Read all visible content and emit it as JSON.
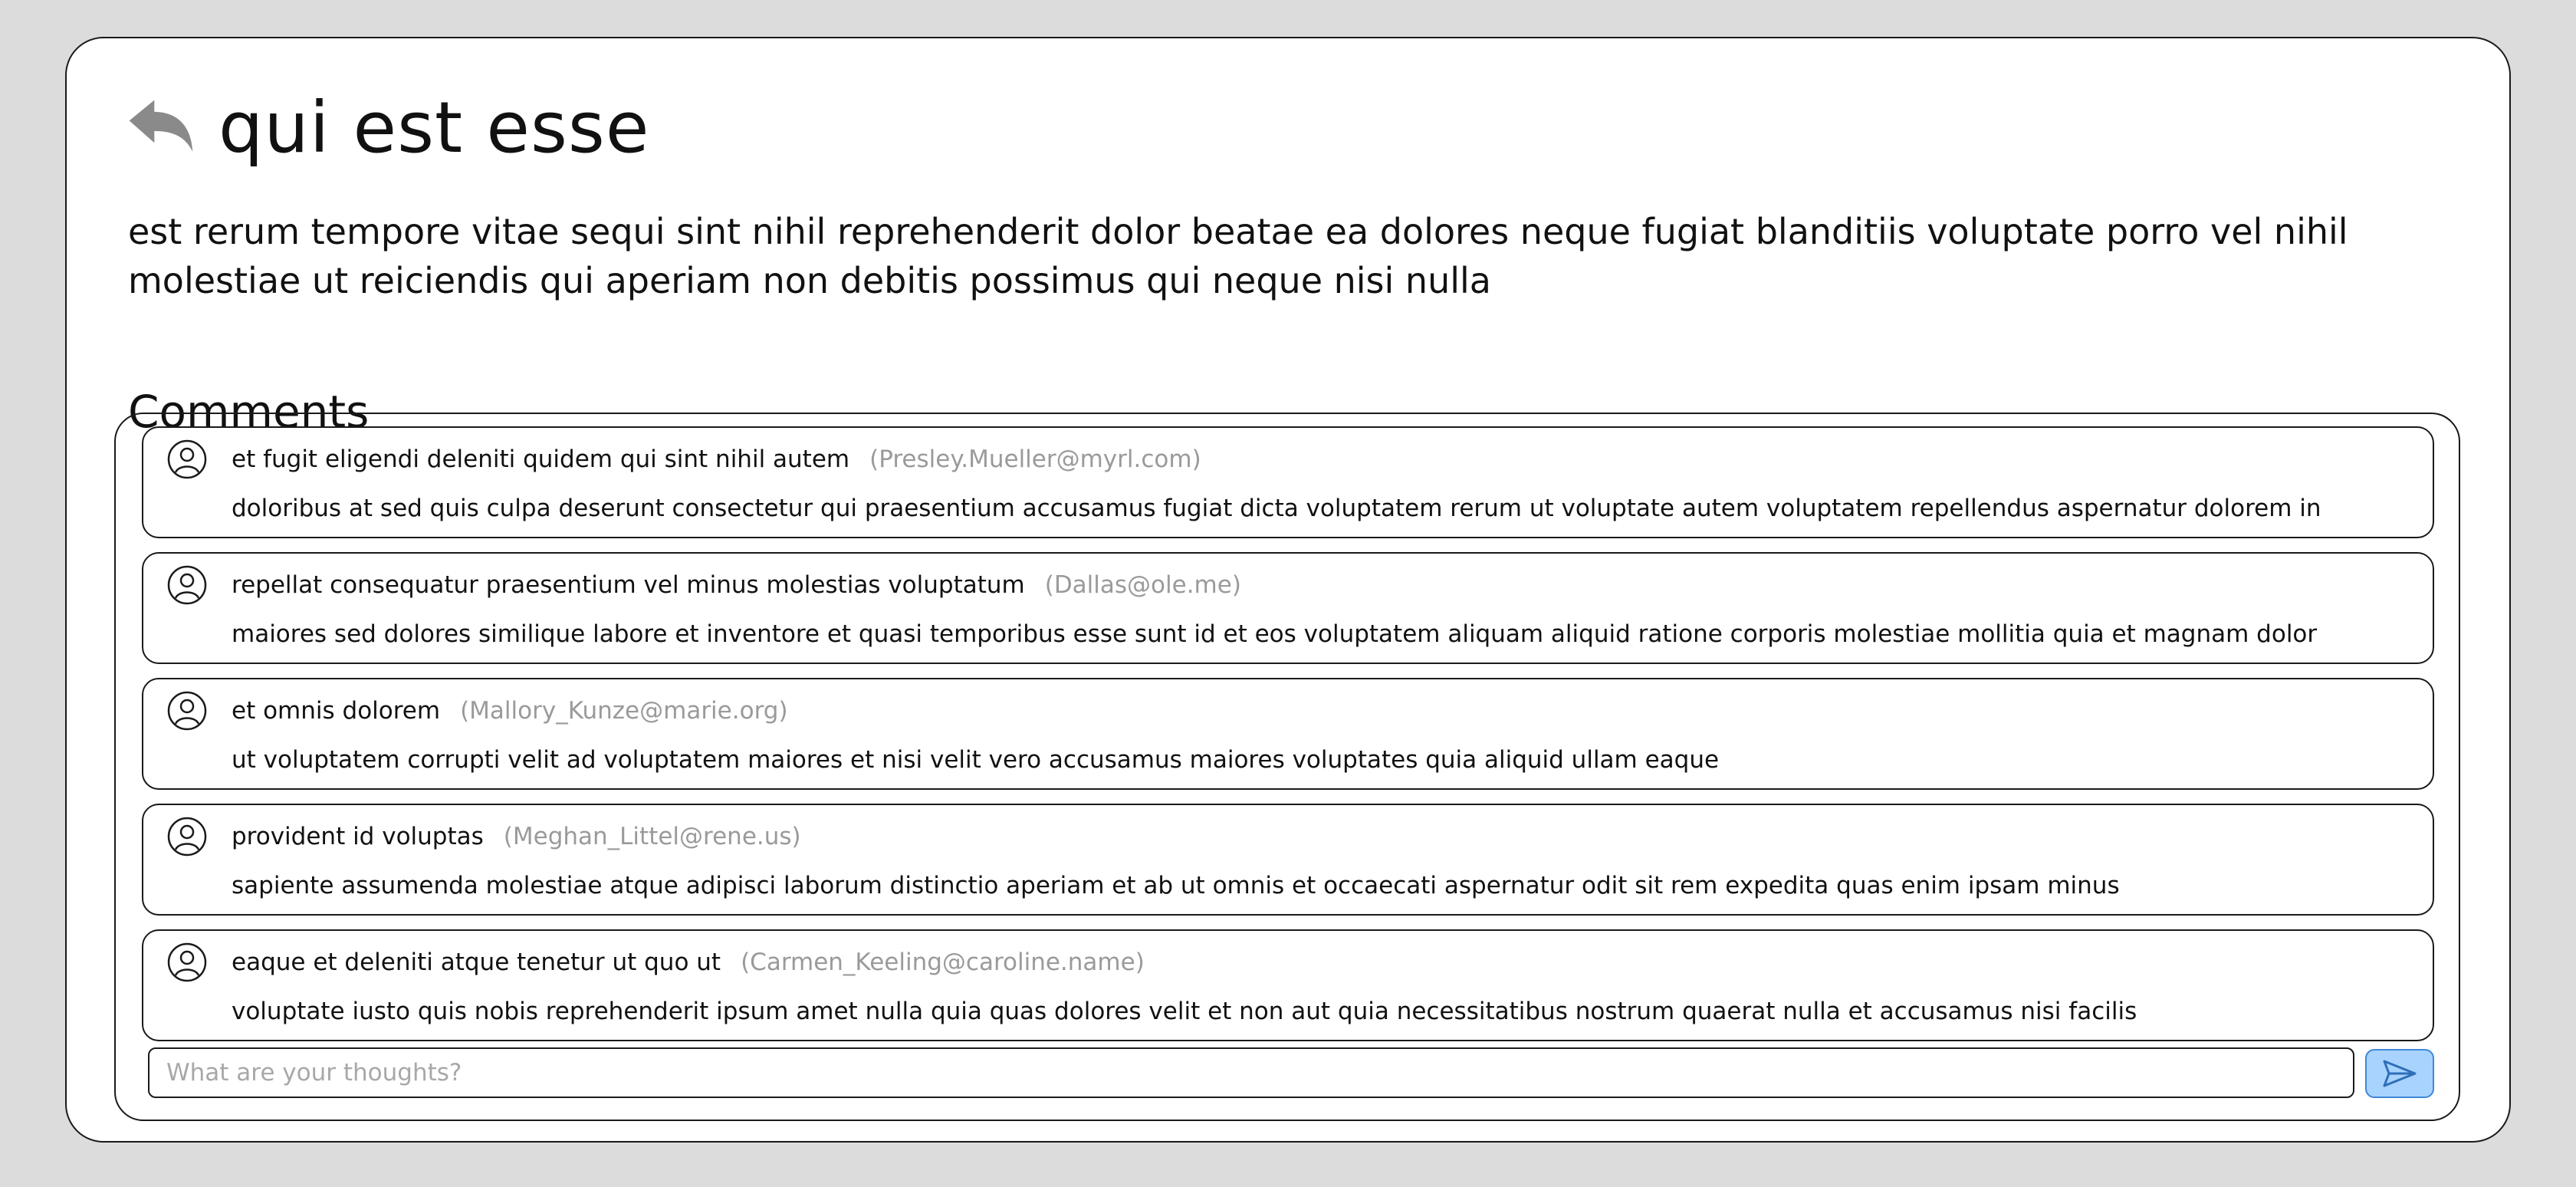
{
  "post": {
    "title": "qui est esse",
    "body": "est rerum tempore vitae sequi sint nihil reprehenderit dolor beatae ea dolores neque fugiat blanditiis voluptate porro vel nihil molestiae ut reiciendis qui aperiam non debitis possimus qui neque nisi nulla"
  },
  "comments_section": {
    "heading": "Comments",
    "comments": [
      {
        "title": "et fugit eligendi deleniti quidem qui sint nihil autem",
        "email": "(Presley.Mueller@myrl.com)",
        "body": "doloribus at sed quis culpa deserunt consectetur qui praesentium accusamus fugiat dicta voluptatem rerum ut voluptate autem voluptatem repellendus aspernatur dolorem in"
      },
      {
        "title": "repellat consequatur praesentium vel minus molestias voluptatum",
        "email": "(Dallas@ole.me)",
        "body": "maiores sed dolores similique labore et inventore et quasi temporibus esse sunt id et eos voluptatem aliquam aliquid ratione corporis molestiae mollitia quia et magnam dolor"
      },
      {
        "title": "et omnis dolorem",
        "email": "(Mallory_Kunze@marie.org)",
        "body": "ut voluptatem corrupti velit ad voluptatem maiores et nisi velit vero accusamus maiores voluptates quia aliquid ullam eaque"
      },
      {
        "title": "provident id voluptas",
        "email": "(Meghan_Littel@rene.us)",
        "body": "sapiente assumenda molestiae atque adipisci laborum distinctio aperiam et ab ut omnis et occaecati aspernatur odit sit rem expedita quas enim ipsam minus"
      },
      {
        "title": "eaque et deleniti atque tenetur ut quo ut",
        "email": "(Carmen_Keeling@caroline.name)",
        "body": "voluptate iusto quis nobis reprehenderit ipsum amet nulla quia quas dolores velit et non aut quia necessitatibus nostrum quaerat nulla et accusamus nisi facilis"
      }
    ],
    "input": {
      "placeholder": "What are your thoughts?",
      "value": ""
    }
  },
  "icons": {
    "back": "reply-arrow-icon",
    "avatar": "user-circle-icon",
    "send": "paper-plane-icon"
  },
  "colors": {
    "background": "#dcdcdc",
    "card": "#ffffff",
    "border": "#1a1a1a",
    "muted_text": "#9a9a9a",
    "send_fill": "#a9d3ff",
    "send_border": "#3f87d6"
  }
}
